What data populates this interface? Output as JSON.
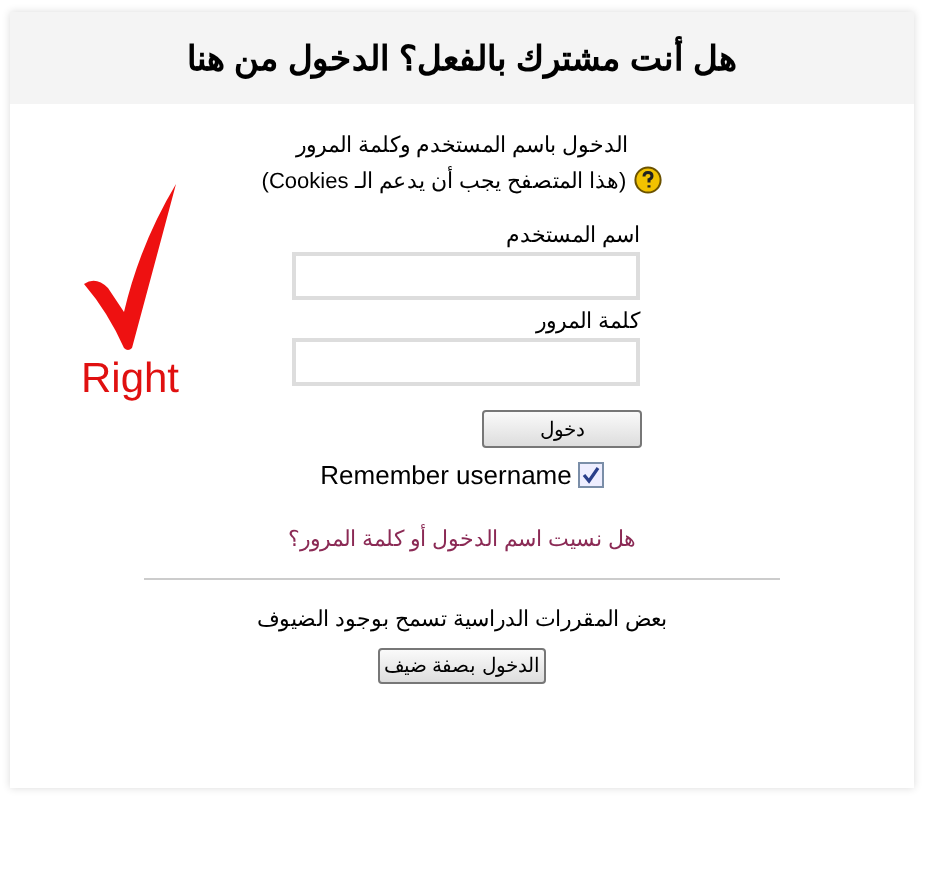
{
  "title": "هل أنت مشترك بالفعل؟ الدخول من هنا",
  "intro": "الدخول باسم المستخدم وكلمة المرور",
  "cookies_note": "(هذا المتصفح يجب أن يدعم الـ Cookies)",
  "annotation": {
    "label": "Right"
  },
  "fields": [
    {
      "label": "اسم المستخدم"
    },
    {
      "label": "كلمة المرور"
    }
  ],
  "login_button": "دخول",
  "remember": {
    "label": "Remember username",
    "checked": true
  },
  "forgot_link": "هل نسيت اسم الدخول أو كلمة المرور؟",
  "guest_note": "بعض المقررات الدراسية تسمح بوجود الضيوف",
  "guest_button": "الدخول بصفة ضيف"
}
